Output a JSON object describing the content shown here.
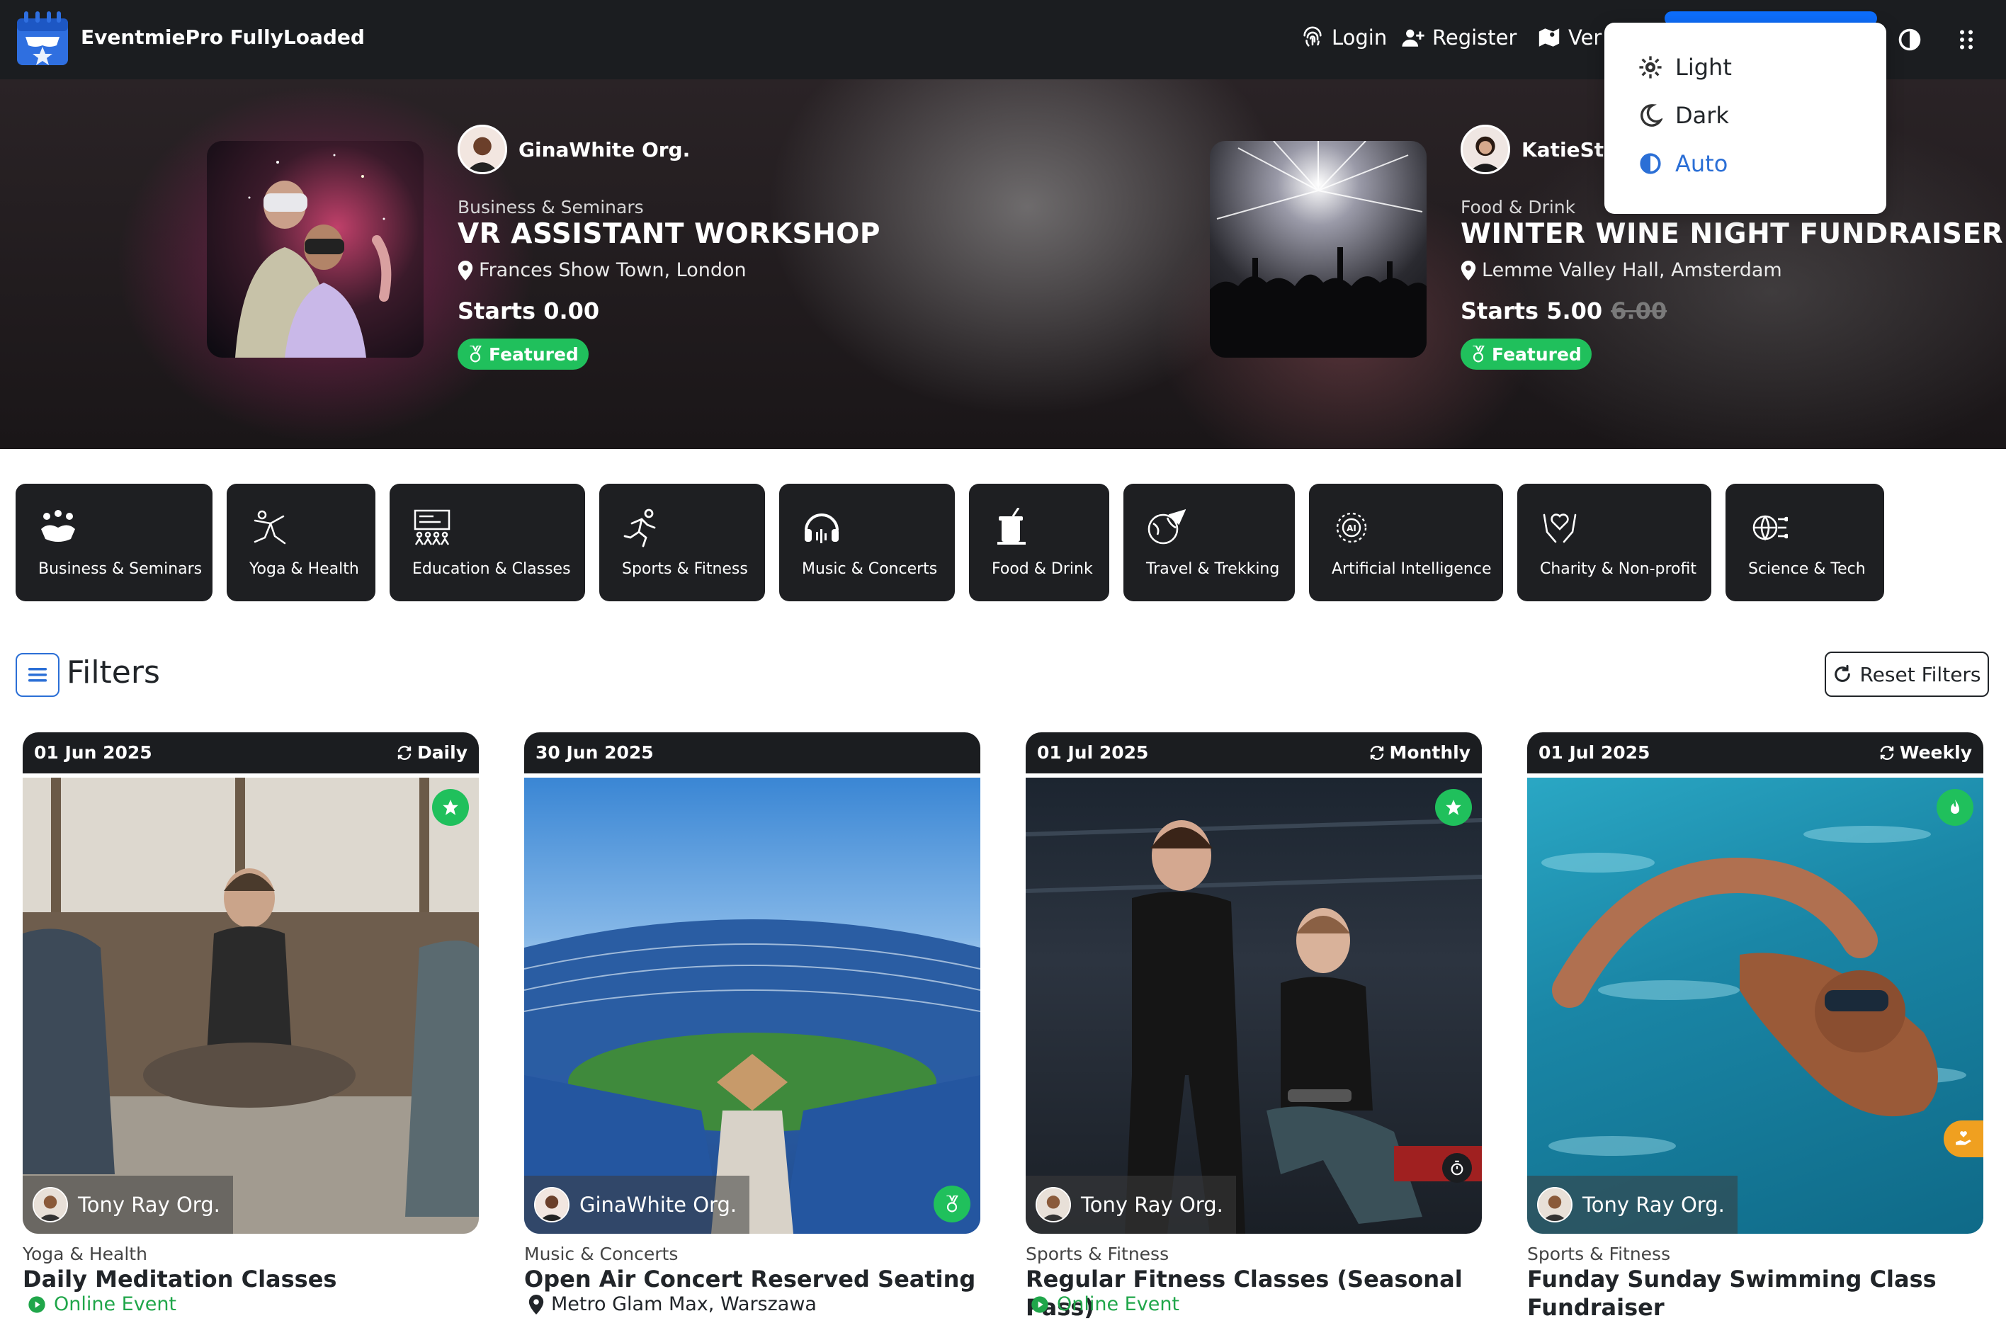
{
  "navbar": {
    "brand": "EventmiePro FullyLoaded",
    "login": "Login",
    "register": "Register",
    "venues_partial": "Ver"
  },
  "theme_menu": {
    "options": [
      "Light",
      "Dark",
      "Auto"
    ],
    "selected": "Auto"
  },
  "hero": {
    "slides": [
      {
        "organizer": "GinaWhite Org.",
        "category": "Business & Seminars",
        "title": "VR ASSISTANT WORKSHOP",
        "venue": "Frances Show Town, London",
        "price": "Starts 0.00",
        "badge": "Featured"
      },
      {
        "organizer": "KatieSto",
        "category": "Food & Drink",
        "title": "WINTER WINE NIGHT FUNDRAISER",
        "venue": "Lemme Valley Hall, Amsterdam",
        "price": "Starts 5.00",
        "old_price": "6.00",
        "badge": "Featured"
      }
    ]
  },
  "categories": [
    {
      "label": "Business & Seminars",
      "icon": "handshake-icon"
    },
    {
      "label": "Yoga & Health",
      "icon": "yoga-icon"
    },
    {
      "label": "Education & Classes",
      "icon": "classroom-icon"
    },
    {
      "label": "Sports & Fitness",
      "icon": "runner-icon"
    },
    {
      "label": "Music & Concerts",
      "icon": "headphones-icon"
    },
    {
      "label": "Food & Drink",
      "icon": "drink-icon"
    },
    {
      "label": "Travel & Trekking",
      "icon": "globe-plane-icon"
    },
    {
      "label": "Artificial Intelligence",
      "icon": "ai-chip-icon"
    },
    {
      "label": "Charity & Non-profit",
      "icon": "heart-hands-icon"
    },
    {
      "label": "Science & Tech",
      "icon": "tech-globe-icon"
    }
  ],
  "filters": {
    "title": "Filters",
    "reset": "Reset Filters"
  },
  "events": [
    {
      "date": "01 Jun 2025",
      "repeat": "Daily",
      "organizer": "Tony Ray Org.",
      "category": "Yoga & Health",
      "title": "Daily Meditation Classes",
      "meta": "Online Event",
      "meta_type": "online"
    },
    {
      "date": "30 Jun 2025",
      "repeat": "",
      "organizer": "GinaWhite Org.",
      "category": "Music & Concerts",
      "title": "Open Air Concert Reserved Seating",
      "meta": "Metro Glam Max, Warszawa",
      "meta_type": "venue"
    },
    {
      "date": "01 Jul 2025",
      "repeat": "Monthly",
      "organizer": "Tony Ray Org.",
      "category": "Sports & Fitness",
      "title": "Regular Fitness Classes (Seasonal Pass)",
      "meta": "Online Event",
      "meta_type": "online"
    },
    {
      "date": "01 Jul 2025",
      "repeat": "Weekly",
      "organizer": "Tony Ray Org.",
      "category": "Sports & Fitness",
      "title": "Funday Sunday Swimming Class Fundraiser",
      "meta": "",
      "meta_type": "none"
    }
  ],
  "colors": {
    "navbar": "#1b1d20",
    "accent_blue": "#2b6fd6",
    "featured_green": "#20c05c",
    "online_green": "#20a64a",
    "badge_orange": "#f0a020"
  }
}
